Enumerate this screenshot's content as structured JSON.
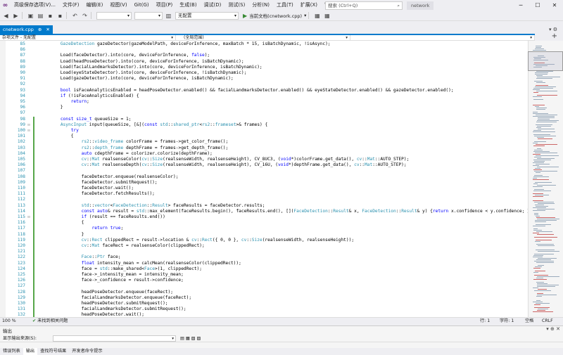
{
  "menubar": {
    "items": [
      "高级保存选项(V)...",
      "文件(F)",
      "编辑(E)",
      "视图(V)",
      "Git(G)",
      "项目(P)",
      "生成(B)",
      "调试(D)",
      "测试(S)",
      "分析(N)",
      "工具(T)",
      "扩展(X)",
      "窗口(W)",
      "帮助(H)"
    ],
    "search_placeholder": "搜索 (Ctrl+Q)",
    "project_name": "network"
  },
  "toolbar": {
    "config_combo": "",
    "platform_combo": "",
    "file_combo": "无配置",
    "run_label": "当前文档(cnetwork.cpp)"
  },
  "doc_tab": {
    "label": "cnetwork.cpp"
  },
  "nav": {
    "scope": "杂项文件 - 无配置",
    "context": "(全局范围)"
  },
  "code_lines": [
    {
      "n": "85",
      "t": "        GazeDetection gazeDetector(gazeModelPath, deviceForInference, maxBatch * 15, isBatchDynamic, !isAsync);"
    },
    {
      "n": "86",
      "t": ""
    },
    {
      "n": "87",
      "t": "        Load(faceDetector).into(core, deviceForInference, false);"
    },
    {
      "n": "88",
      "t": "        Load(headPoseDetector).into(core, deviceForInference, isBatchDynamic);"
    },
    {
      "n": "89",
      "t": "        Load(facialLandmarksDetector).into(core, deviceForInference, isBatchDynamic);"
    },
    {
      "n": "90",
      "t": "        Load(eyeStateDetector).into(core, deviceForInference, !isBatchDynamic);"
    },
    {
      "n": "91",
      "t": "        Load(gazeDetector).into(core, deviceForInference, isBatchDynamic);"
    },
    {
      "n": "92",
      "t": ""
    },
    {
      "n": "93",
      "t": "        bool isFaceAnalyticsEnabled = headPoseDetector.enabled() && facialLandmarksDetector.enabled() && eyeStateDetector.enabled() && gazeDetector.enabled();"
    },
    {
      "n": "94",
      "t": "        if (!isFaceAnalyticsEnabled) {"
    },
    {
      "n": "95",
      "t": "            return;"
    },
    {
      "n": "96",
      "t": "        }"
    },
    {
      "n": "97",
      "t": ""
    },
    {
      "n": "98",
      "t": "        const size_t queueSize = 1;"
    },
    {
      "n": "99",
      "t": "        AsyncInput input(queueSize, [&](const std::shared_ptr<rs2::frameset>& frames) {"
    },
    {
      "n": "100",
      "t": "            try"
    },
    {
      "n": "101",
      "t": "            {"
    },
    {
      "n": "102",
      "t": "                rs2::video_frame colorFrame = frames->get_color_frame();"
    },
    {
      "n": "103",
      "t": "                rs2::depth_frame depthFrame = frames->get_depth_frame();"
    },
    {
      "n": "104",
      "t": "                auto cdepthFrame = colorizer.colorize(depthFrame);"
    },
    {
      "n": "105",
      "t": "                cv::Mat realsenseColor(cv::Size(realsenseWidth, realsenseHeight), CV_8UC3, (void*)colorFrame.get_data(), cv::Mat::AUTO_STEP);"
    },
    {
      "n": "106",
      "t": "                cv::Mat realsenseDepth(cv::Size(realsenseWidth, realsenseHeight), CV_16U, (void*)depthFrame.get_data(), cv::Mat::AUTO_STEP);"
    },
    {
      "n": "107",
      "t": ""
    },
    {
      "n": "108",
      "t": "                faceDetector.enqueue(realsenseColor);"
    },
    {
      "n": "109",
      "t": "                faceDetector.submitRequest();"
    },
    {
      "n": "110",
      "t": "                faceDetector.wait();"
    },
    {
      "n": "111",
      "t": "                faceDetector.fetchResults();"
    },
    {
      "n": "112",
      "t": ""
    },
    {
      "n": "113",
      "t": "                std::vector<FaceDetection::Result> faceResults = faceDetector.results;"
    },
    {
      "n": "114",
      "t": "                const auto& result = std::max_element(faceResults.begin(), faceResults.end(), [](FaceDetection::Result& x, FaceDetection::Result& y) {return x.confidence < y.confidence; });"
    },
    {
      "n": "115",
      "t": "                if (result == faceResults.end())"
    },
    {
      "n": "116",
      "t": "                {"
    },
    {
      "n": "117",
      "t": "                    return true;"
    },
    {
      "n": "118",
      "t": "                }"
    },
    {
      "n": "119",
      "t": "                cv::Rect clippedRect = result->location & cv::Rect({ 0, 0 }, cv::Size(realsenseWidth, realsenseHeight));"
    },
    {
      "n": "120",
      "t": "                cv::Mat faceRect = realsenseColor(clippedRect);"
    },
    {
      "n": "121",
      "t": ""
    },
    {
      "n": "122",
      "t": "                Face::Ptr face;"
    },
    {
      "n": "123",
      "t": "                float intensity_mean = calcMean(realsenseColor(clippedRect));"
    },
    {
      "n": "124",
      "t": "                face = std::make_shared<Face>(1, clippedRect);"
    },
    {
      "n": "125",
      "t": "                face->_intensity_mean = intensity_mean;"
    },
    {
      "n": "126",
      "t": "                face->_confidence = result->confidence;"
    },
    {
      "n": "127",
      "t": ""
    },
    {
      "n": "128",
      "t": "                headPoseDetector.enqueue(faceRect);"
    },
    {
      "n": "129",
      "t": "                facialLandmarksDetector.enqueue(faceRect);"
    },
    {
      "n": "130",
      "t": "                headPoseDetector.submitRequest();"
    },
    {
      "n": "131",
      "t": "                facialLandmarksDetector.submitRequest();"
    },
    {
      "n": "132",
      "t": "                headPoseDetector.wait();"
    },
    {
      "n": "133",
      "t": "                facialLandmarksDetector.wait();"
    }
  ],
  "status": {
    "zoom": "100 %",
    "issues": "未找到相关问题",
    "line": "行: 1",
    "char": "字符: 1",
    "mode": "空格",
    "eol": "CRLF"
  },
  "output": {
    "title": "输出",
    "source_label": "显示输出来源(S):"
  },
  "bottom_tabs": [
    "错误列表",
    "输出",
    "查找符号结果",
    "开发者命令提示"
  ],
  "colors": {
    "accent": "#007acc",
    "line_number": "#2b91af",
    "type": "#2b91af",
    "keyword": "#0000ff",
    "string": "#a31515",
    "change_bar": "#57a64a"
  }
}
